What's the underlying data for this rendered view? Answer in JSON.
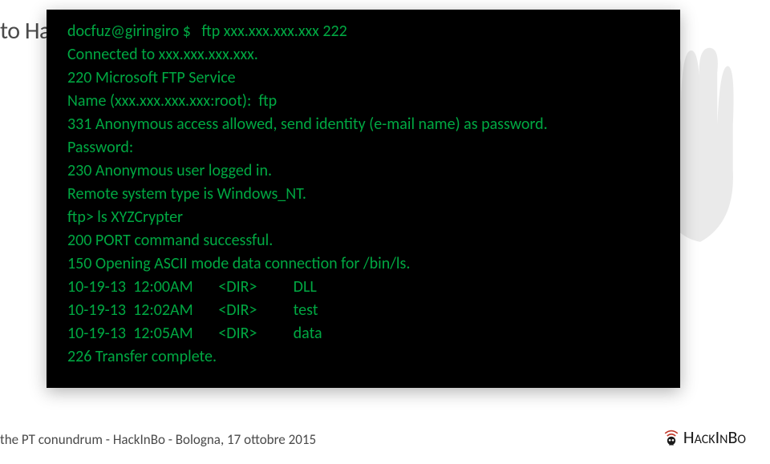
{
  "slide": {
    "title": "to Hash or not to Hash"
  },
  "terminal": {
    "lines": [
      "docfuz@giringiro $   ftp xxx.xxx.xxx.xxx 222",
      "Connected to xxx.xxx.xxx.xxx.",
      "220 Microsoft FTP Service",
      "Name (xxx.xxx.xxx.xxx:root):  ftp",
      "331 Anonymous access allowed, send identity (e-mail name) as password.",
      "Password:",
      "230 Anonymous user logged in.",
      "Remote system type is Windows_NT.",
      "ftp> ls XYZCrypter",
      "200 PORT command successful.",
      "150 Opening ASCII mode data connection for /bin/ls.",
      "10-19-13  12:00AM       <DIR>          DLL",
      "10-19-13  12:02AM       <DIR>          test",
      "10-19-13  12:05AM       <DIR>          data",
      "226 Transfer complete."
    ]
  },
  "footer": {
    "text": "the PT conundrum - HackInBo - Bologna, 17 ottobre 2015"
  },
  "logo": {
    "prefix": "H",
    "mid": "ACK",
    "in": "I",
    "n": "N",
    "suffix": "B",
    "o": "O"
  }
}
